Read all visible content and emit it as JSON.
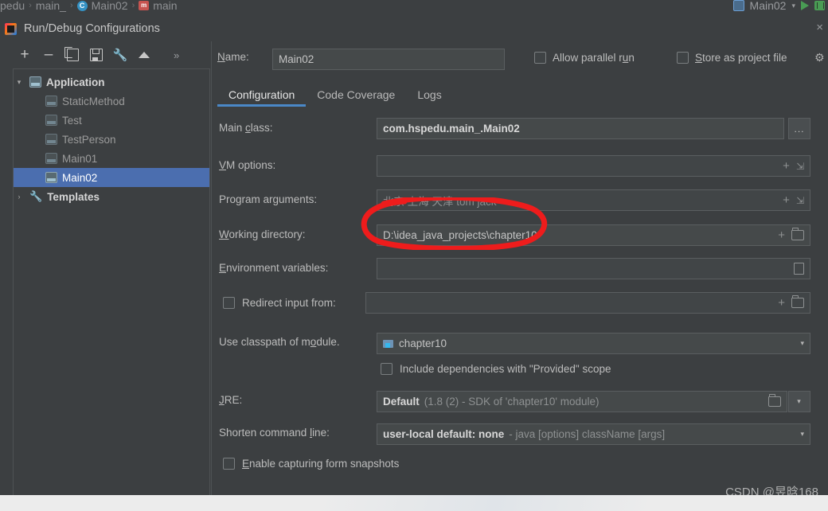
{
  "ide_strip": {
    "breadcrumb": [
      {
        "label": "pedu",
        "icon": ""
      },
      {
        "label": "main_",
        "icon": ""
      },
      {
        "label": "Main02",
        "icon": "class-icon"
      },
      {
        "label": "main",
        "icon": "method-icon"
      }
    ],
    "separator": "›",
    "run_config_name": "Main02",
    "run_button": "run-icon",
    "debug_button": "debug-icon",
    "caret": "▾"
  },
  "dialog": {
    "title": "Run/Debug Configurations",
    "close_label": "×"
  },
  "left_panel": {
    "toolbar": [
      {
        "name": "add-configuration-button",
        "glyph": "+"
      },
      {
        "name": "remove-configuration-button",
        "glyph": "–"
      },
      {
        "name": "copy-configuration-button",
        "glyph": "copy-icon"
      },
      {
        "name": "save-configuration-button",
        "glyph": "save-icon"
      },
      {
        "name": "edit-templates-button",
        "glyph": "wrench-icon"
      },
      {
        "name": "move-up-button",
        "glyph": "up-arrow-icon"
      },
      {
        "name": "more-options-button",
        "glyph": "»"
      }
    ],
    "tree": [
      {
        "label": "Application",
        "type": "group",
        "expanded": true,
        "arrow": "∨",
        "selected": false
      },
      {
        "label": "StaticMethod",
        "type": "item",
        "selected": false
      },
      {
        "label": "Test",
        "type": "item",
        "selected": false
      },
      {
        "label": "TestPerson",
        "type": "item",
        "selected": false
      },
      {
        "label": "Main01",
        "type": "item",
        "selected": false
      },
      {
        "label": "Main02",
        "type": "item",
        "selected": true
      },
      {
        "label": "Templates",
        "type": "group",
        "expanded": false,
        "arrow": "›",
        "selected": false
      }
    ]
  },
  "form": {
    "name_label": "Name:",
    "name_value": "Main02",
    "allow_parallel_run": "Allow parallel run",
    "store_as_project_file": "Store as project file",
    "gear_icon": "gear-icon",
    "tabs": [
      {
        "label": "Configuration",
        "active": true
      },
      {
        "label": "Code Coverage",
        "active": false
      },
      {
        "label": "Logs",
        "active": false
      }
    ],
    "main_class_label": "Main class:",
    "main_class_value": "com.hspedu.main_.Main02",
    "main_class_browse": "...",
    "vm_options_label": "VM options:",
    "vm_options_value": "",
    "program_arguments_label": "Program arguments:",
    "program_arguments_value": "北京 上海 天津 tom jack",
    "working_directory_label": "Working directory:",
    "working_directory_value": "D:\\idea_java_projects\\chapter10",
    "environment_variables_label": "Environment variables:",
    "environment_variables_value": "",
    "redirect_input_label": "Redirect input from:",
    "redirect_input_value": "",
    "use_classpath_label": "Use classpath of module.",
    "use_classpath_value": "chapter10",
    "include_dependencies": "Include dependencies with \"Provided\" scope",
    "jre_label": "JRE:",
    "jre_value_strong": "Default",
    "jre_value_dim": "(1.8 (2) - SDK of 'chapter10' module)",
    "shorten_command_label": "Shorten command line:",
    "shorten_command_strong": "user-local default: none",
    "shorten_command_dim": "- java [options] className [args]",
    "enable_snapshots": "Enable capturing form snapshots"
  },
  "annotation": {
    "type": "red-ellipse",
    "color": "#ee1c1c",
    "targets": "program-arguments-field"
  },
  "watermark": "CSDN @昱晗168",
  "colors": {
    "dialog_bg": "#3c3f41",
    "field_bg": "#45494a",
    "selection": "#4b6eaf",
    "tab_underline": "#4a88c7",
    "annotation_red": "#ee1c1c"
  }
}
